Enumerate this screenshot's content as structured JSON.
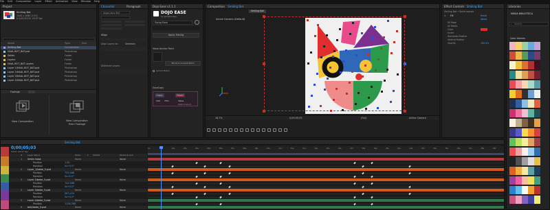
{
  "menu": [
    "File",
    "Edit",
    "Composition",
    "Layer",
    "Effect",
    "Animation",
    "View",
    "Window",
    "Help"
  ],
  "project_panel": {
    "title": "Project",
    "comp_name": "Smiling Bot",
    "comp_info": "1440 x 1080 (1.00)",
    "comp_info2": "Δ 0;00;30;00, 29.97 fps",
    "columns": [
      "Name",
      "Type",
      "Size"
    ],
    "items": [
      {
        "name": "Smiling Bot",
        "type": "Composition"
      },
      {
        "name": "HAAL.BOT_BAT.psd",
        "type": "Photoshop"
      },
      {
        "name": "Solids",
        "type": "Folder"
      },
      {
        "name": "Layers",
        "type": "Folder"
      },
      {
        "name": "HAAL.BOT_BAT Layers",
        "type": "Folder"
      },
      {
        "name": "Layer 1/HAAL.BOT_BAT.psd",
        "type": "Photoshop"
      },
      {
        "name": "Layer 2/HAAL.BOT_BAT.psd",
        "type": "Photoshop"
      },
      {
        "name": "Layer 3/HAAL.BOT_BAT.psd",
        "type": "Photoshop"
      },
      {
        "name": "Layer 4/HAAL.BOT_BAT.psd",
        "type": "Photoshop"
      }
    ],
    "footage_label": "Footage",
    "new_comp": "New Composition",
    "new_comp_footage_1": "New Composition",
    "new_comp_footage_2": "From Footage"
  },
  "character_panel": {
    "tabs": [
      "Character",
      "Paragraph"
    ],
    "font": "Ango Lans Std",
    "align_label": "Align",
    "align_to": "Align Layers to:",
    "selection": "Selection",
    "distribute": "Distribute Layers"
  },
  "dojo_panel": {
    "tab": "Dojo Ease v1.1.1",
    "brand": "DOJO EASE",
    "brand_sub": "by @motiondojo",
    "preset": "Swing Ease",
    "apply": "Apply Easing",
    "anchor": "Move Anchor Point",
    "move_btn": "Move to Current Point",
    "ignore_masks": "Ignore Masks",
    "ease_copy": "EaseCopy",
    "copy_btn": "Copy",
    "paste_btn": "Paste",
    "val1": "100",
    "val2": "75%",
    "val3": "Value",
    "keep_label": "Keep Amount"
  },
  "comp_panel": {
    "tab": "Composition",
    "tab_name": "Smiling Bot",
    "crumb": "Smiling Bot",
    "camera": "Active Camera (Default)",
    "zoom": "16.7%",
    "quality": "(Full)",
    "timecode": "0;00;05;05",
    "resolution": "Full",
    "camera_select": "Active Camera",
    "view": "1 View"
  },
  "effect_panel": {
    "tab": "Effect Controls",
    "tab_name": "Smiling Bot",
    "layer": "Smiling Bot • Smile mosaic",
    "fx_name": "Fill",
    "reset": "Reset",
    "about": "About",
    "props": [
      "Fill Mask",
      "All Masks",
      "Color",
      "Invert",
      "Horizontal Feather",
      "Vertical Feather",
      "Opacity"
    ],
    "opacity_val": "100.0%"
  },
  "libraries_panel": {
    "title": "Libraries",
    "library_name": "MIXKA BIBLIOTECA",
    "search_placeholder": "Search",
    "section": "Color themes"
  },
  "timeline": {
    "comp_tab": "Smiling Bot",
    "timecode": "0;00;05;03",
    "fps_info": "00153 (29.97 fps)",
    "col_headers": [
      "#",
      "Layer Name",
      "Mode",
      "T",
      "TrkMat",
      "Parent & Link"
    ],
    "ruler": [
      "0s",
      "01s",
      "02s",
      "03s",
      "04s",
      "05s",
      "06s",
      "07s",
      "08s",
      "09s",
      "10s",
      "11s",
      "12s",
      "13s",
      "14s",
      "15s",
      "16s",
      "17s",
      "18s",
      "19s",
      "20s",
      "21s",
      "22s",
      "23s",
      "24s",
      "25s",
      "26s",
      "27s",
      "28s",
      "29s"
    ],
    "layers": [
      {
        "num": "1",
        "name": "Smile mask",
        "mode": "Norm",
        "parent": "None"
      },
      {
        "num": "",
        "name": "Position",
        "mode": "",
        "parent": "1,00"
      },
      {
        "num": "",
        "name": "Rotation",
        "mode": "",
        "parent": "0x+0.0°"
      },
      {
        "num": "2",
        "name": "Layer_1/bebe_5.psd",
        "mode": "Norm",
        "parent": "None"
      },
      {
        "num": "",
        "name": "Position",
        "mode": "",
        "parent": "753,966"
      },
      {
        "num": "",
        "name": "Rotation",
        "mode": "",
        "parent": "0x+0.0°"
      },
      {
        "num": "3",
        "name": "Layer 2/bebe_5.psd",
        "mode": "Norm",
        "parent": "None"
      },
      {
        "num": "",
        "name": "Position",
        "mode": "",
        "parent": "742,568"
      },
      {
        "num": "",
        "name": "Rotation",
        "mode": "",
        "parent": "0x+0.0°"
      },
      {
        "num": "4",
        "name": "Layer 3/bebe_5.psd",
        "mode": "Norm",
        "parent": "None"
      },
      {
        "num": "",
        "name": "Position",
        "mode": "",
        "parent": "567,424"
      },
      {
        "num": "",
        "name": "Rotation",
        "mode": "",
        "parent": "0x+0.0°"
      },
      {
        "num": "5",
        "name": "Layer 4/bebe_5.psd",
        "mode": "Norm",
        "parent": "None"
      },
      {
        "num": "",
        "name": "Position",
        "mode": "",
        "parent": "1156,268"
      },
      {
        "num": "6",
        "name": "bolt/bebe_5.psd",
        "mode": "Norm",
        "parent": "None"
      }
    ]
  },
  "colors": {
    "accent": "#3da7ff",
    "playhead": "#4a90ff",
    "bar_orange": "#d05a1c",
    "bar_green": "#2f7a4b",
    "bar_blue": "#30409a",
    "bar_red": "#b83a3a"
  }
}
